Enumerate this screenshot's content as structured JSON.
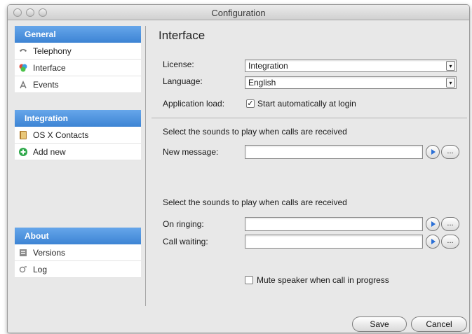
{
  "window": {
    "title": "Configuration"
  },
  "sidebar": {
    "sections": [
      {
        "header": "General",
        "items": [
          {
            "label": "Telephony",
            "icon": "telephone-icon"
          },
          {
            "label": "Interface",
            "icon": "interface-icon"
          },
          {
            "label": "Events",
            "icon": "events-icon"
          }
        ]
      },
      {
        "header": "Integration",
        "items": [
          {
            "label": "OS X Contacts",
            "icon": "contacts-book-icon"
          },
          {
            "label": "Add new",
            "icon": "add-icon"
          }
        ]
      },
      {
        "header": "About",
        "items": [
          {
            "label": "Versions",
            "icon": "versions-icon"
          },
          {
            "label": "Log",
            "icon": "log-icon"
          }
        ]
      }
    ],
    "accent_color": "#4a90e2"
  },
  "main": {
    "heading": "Interface",
    "license": {
      "label": "License:",
      "value": "Integration"
    },
    "language": {
      "label": "Language:",
      "value": "English"
    },
    "app_load": {
      "label": "Application load:",
      "checkbox_label": "Start automatically at login",
      "checked": true
    },
    "sounds_group_1": {
      "title": "Select the sounds to play when calls are received",
      "new_message_label": "New message:",
      "new_message_value": ""
    },
    "sounds_group_2": {
      "title": "Select the sounds to play when calls are received",
      "on_ringing_label": "On ringing:",
      "on_ringing_value": "",
      "call_waiting_label": "Call waiting:",
      "call_waiting_value": ""
    },
    "mute": {
      "label": "Mute speaker when call in progress",
      "checked": false
    },
    "browse_label": "...",
    "check_mark": "✓",
    "dropdown_arrow": "▾"
  },
  "footer": {
    "save_label": "Save",
    "cancel_label": "Cancel"
  }
}
